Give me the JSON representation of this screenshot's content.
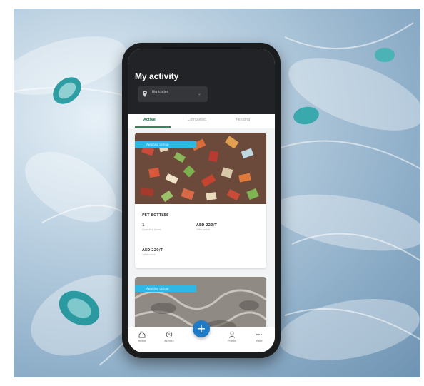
{
  "screen": {
    "title": "My activity",
    "selector_label": "Big trader",
    "tabs": [
      "Active",
      "Completed",
      "Pending"
    ],
    "cards": [
      {
        "banner": "Awaiting pickup",
        "product": "PET BOTTLES",
        "qty": "1",
        "qty_label": "Quantity (tons)",
        "price": "AED 220/T",
        "price_label": "Offer price",
        "total": "AED 220/T",
        "total_label": "Total price"
      },
      {
        "banner": "Awaiting pickup"
      }
    ],
    "nav": {
      "home": "Home",
      "activity": "Activity",
      "fab": "+",
      "profile": "Profile",
      "more": "More"
    }
  },
  "colors": {
    "topbar": "#222326",
    "banner": "#2fb8e6",
    "fab": "#1f7ac8",
    "active_tab": "#2a8a5a"
  }
}
